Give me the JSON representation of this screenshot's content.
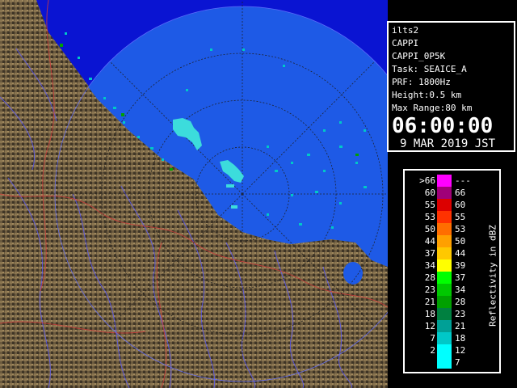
{
  "info": {
    "radar": "ilts2",
    "product": "CAPPI",
    "product_name": "CAPPI_0P5K",
    "task": "Task: SEAICE_A",
    "prf": "PRF: 1800Hz",
    "height": "Height:0.5 km",
    "max_range": "Max Range:80 km",
    "time": "06:00:00",
    "date": "9 MAR 2019 JST"
  },
  "legend": {
    "unit": "Reflectivity in dBZ",
    "rows": [
      {
        "lo": ">66",
        "hi": "---",
        "color": "#ff00ff"
      },
      {
        "lo": "60",
        "hi": "66",
        "color": "#a00078"
      },
      {
        "lo": "55",
        "hi": "60",
        "color": "#dc0000"
      },
      {
        "lo": "53",
        "hi": "55",
        "color": "#ff3200"
      },
      {
        "lo": "50",
        "hi": "53",
        "color": "#ff6e00"
      },
      {
        "lo": "44",
        "hi": "50",
        "color": "#ffa000"
      },
      {
        "lo": "37",
        "hi": "44",
        "color": "#ffc800"
      },
      {
        "lo": "34",
        "hi": "39",
        "color": "#ffff00"
      },
      {
        "lo": "28",
        "hi": "37",
        "color": "#00ff00"
      },
      {
        "lo": "23",
        "hi": "34",
        "color": "#00c800"
      },
      {
        "lo": "21",
        "hi": "28",
        "color": "#00a000"
      },
      {
        "lo": "18",
        "hi": "23",
        "color": "#008040"
      },
      {
        "lo": "12",
        "hi": "21",
        "color": "#00a096"
      },
      {
        "lo": "7",
        "hi": "18",
        "color": "#00c8c8"
      },
      {
        "lo": "2",
        "hi": "12",
        "color": "#00ffff"
      },
      {
        "lo": "",
        "hi": "7",
        "color": "#00ffff"
      }
    ]
  },
  "colors": {
    "sea": "#1e5ae6",
    "out_of_range_sea": "#0a14d2",
    "land": "#6e5a3c",
    "echo": "#3cdcdc"
  }
}
